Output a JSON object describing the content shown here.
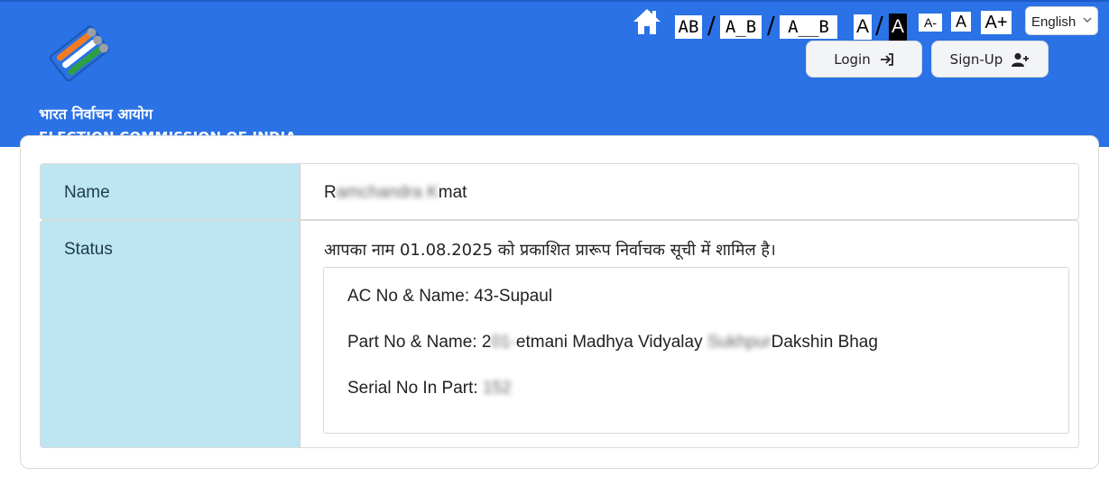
{
  "header": {
    "org_hindi": "भारत निर्वाचन आयोग",
    "org_english": "ELECTION COMMISSION OF INDIA",
    "bg_color": "#2a72e6",
    "icons": {
      "home": "home-icon",
      "login": "sign-in-icon",
      "signup": "add-user-icon",
      "dropdown": "chevron-down-icon"
    }
  },
  "toolbar": {
    "spacing_ab": "AB",
    "spacing_a_b": "A_B",
    "spacing_a__b": "A__B",
    "contrast_normal": "A",
    "contrast_high": "A",
    "font_decrease": "A-",
    "font_normal": "A",
    "font_increase": "A+"
  },
  "language": {
    "selected": "English"
  },
  "buttons": {
    "login": "Login",
    "signup": "Sign-Up"
  },
  "details": {
    "name_label": "Name",
    "name_value_start": "R",
    "name_value_redacted": "amchandra K",
    "name_value_end": "mat",
    "status_label": "Status",
    "status_text": "आपका नाम 01.08.2025 को प्रकाशित प्रारूप निर्वाचक सूची में शामिल है।",
    "ac_label": "AC No & Name: 43-Supaul",
    "part_label": "Part No & Name: 2",
    "part_redacted": "01-",
    "part_mid": "etmani Madhya Vidyalay",
    "part_redacted2": "Sukhpur",
    "part_end": "Dakshin Bhag",
    "serial_label": "Serial No In Part:",
    "serial_redacted": "152"
  }
}
